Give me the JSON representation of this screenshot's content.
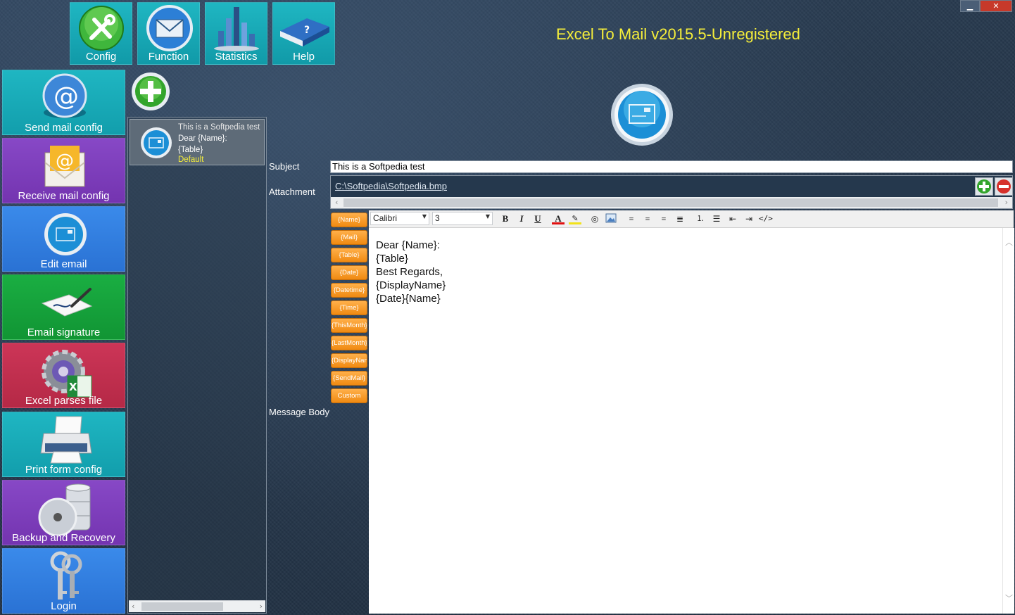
{
  "window": {
    "title": "Excel To Mail v2015.5-Unregistered",
    "minimize_icon": "minimize-icon",
    "close_icon": "close-icon"
  },
  "top_tiles": [
    {
      "label": "Config",
      "icon": "wrench-icon"
    },
    {
      "label": "Function",
      "icon": "envelope-icon"
    },
    {
      "label": "Statistics",
      "icon": "bar-chart-icon"
    },
    {
      "label": "Help",
      "icon": "book-icon"
    }
  ],
  "sidebar": [
    {
      "label": "Send mail config",
      "icon": "at-icon",
      "color": "#1aaab8"
    },
    {
      "label": "Receive mail config",
      "icon": "mail-at-icon",
      "color": "#7b3fb8"
    },
    {
      "label": "Edit email",
      "icon": "edit-mail-icon",
      "color": "#2f7de0"
    },
    {
      "label": "Email signature",
      "icon": "signature-icon",
      "color": "#17a43b"
    },
    {
      "label": "Excel parses file",
      "icon": "excel-gear-icon",
      "color": "#c4304f"
    },
    {
      "label": "Print form config",
      "icon": "printer-icon",
      "color": "#1aaab8"
    },
    {
      "label": "Backup and Recovery",
      "icon": "database-icon",
      "color": "#7b3fb8"
    },
    {
      "label": "Login",
      "icon": "keys-icon",
      "color": "#2f7de0"
    }
  ],
  "template_list": {
    "add_icon": "plus-circle-icon",
    "items": [
      {
        "subject": "This is a Softpedia test",
        "line1": "Dear {Name}:",
        "line2": "{Table}",
        "status": "Default"
      }
    ]
  },
  "form": {
    "subject_label": "Subject",
    "subject_value": "This is a Softpedia test",
    "attachment_label": "Attachment",
    "attachment_path": "C:\\Softpedia\\Softpedia.bmp",
    "message_label": "Message Body"
  },
  "tags": [
    "{Name}",
    "{Mail}",
    "{Table}",
    "{Date}",
    "{Datetime}",
    "{Time}",
    "{ThisMonth}",
    "{LastMonth}",
    "{DisplayName}",
    "{SendMail}",
    "Custom"
  ],
  "editor_toolbar": {
    "font": "Calibri",
    "size": "3"
  },
  "message_body": [
    "Dear {Name}:",
    "{Table}",
    "Best Regards,",
    "{DisplayName}",
    "{Date}{Name}"
  ],
  "colors": {
    "accent_yellow": "#f5ee3a",
    "tag_orange": "#f59a22"
  }
}
